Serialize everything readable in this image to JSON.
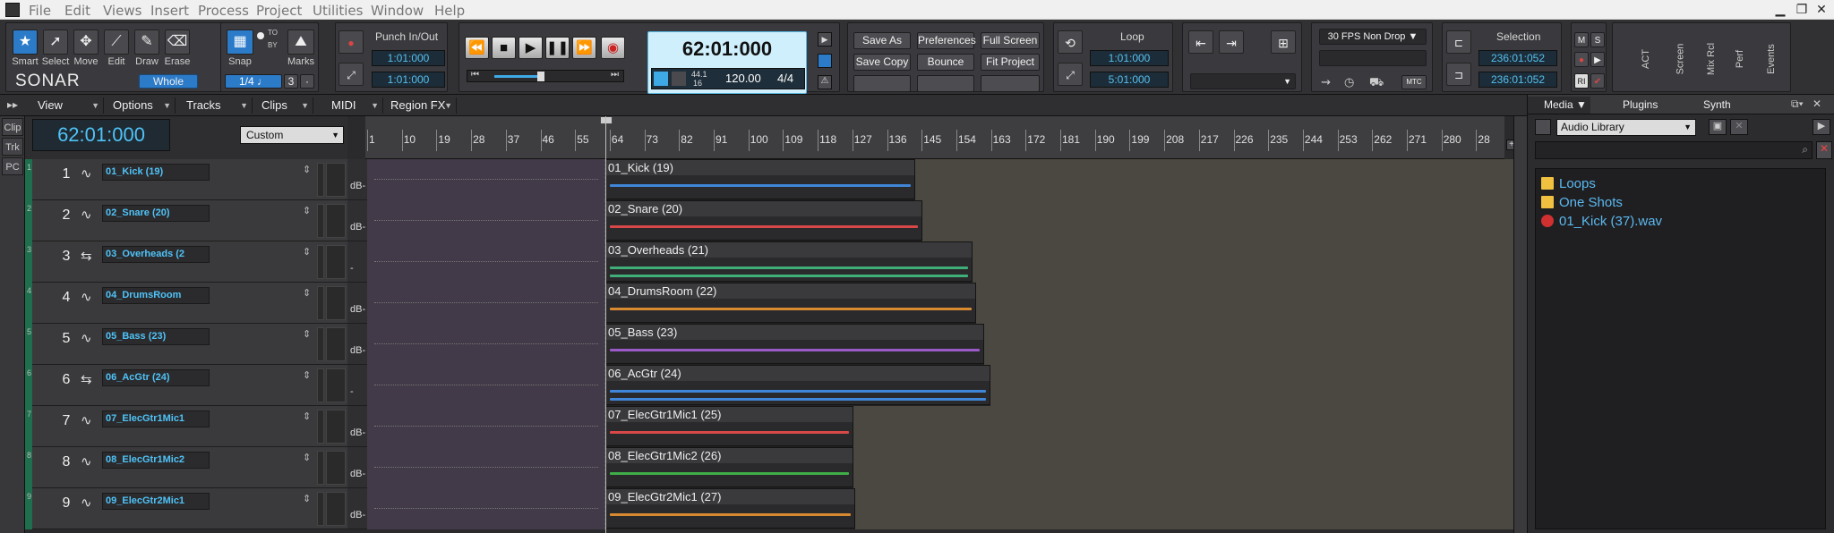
{
  "menu": [
    "File",
    "Edit",
    "Views",
    "Insert",
    "Process",
    "Project",
    "Utilities",
    "Window",
    "Help"
  ],
  "tools": [
    {
      "label": "Smart",
      "icon": "star-icon",
      "selected": true
    },
    {
      "label": "Select",
      "icon": "arrow-icon"
    },
    {
      "label": "Move",
      "icon": "move-icon"
    },
    {
      "label": "Edit",
      "icon": "edit-icon"
    },
    {
      "label": "Draw",
      "icon": "pencil-icon"
    },
    {
      "label": "Erase",
      "icon": "eraser-icon"
    }
  ],
  "logo": "SONAR",
  "whole_label": "Whole",
  "snap_label": "Snap",
  "snap_value": "1/4",
  "snap_num": "3",
  "marks_label": "Marks",
  "to_label": "TO",
  "by_label": "BY",
  "punch": {
    "title": "Punch In/Out",
    "start": "1:01:000",
    "end": "1:01:000"
  },
  "transport": {
    "time": "62:01:000",
    "sample_rate": "44.1",
    "bit_depth": "16",
    "tempo": "120.00",
    "meter": "4/4"
  },
  "buttons": {
    "save_as": "Save As",
    "preferences": "Preferences",
    "full_screen": "Full Screen",
    "save_copy": "Save Copy",
    "bounce": "Bounce",
    "fit_project": "Fit Project"
  },
  "loop": {
    "title": "Loop",
    "start": "1:01:000",
    "end": "5:01:000"
  },
  "fps": "30 FPS Non Drop",
  "mtc": "MTC",
  "selection": {
    "title": "Selection",
    "start": "236:01:052",
    "end": "236:01:052"
  },
  "right_mods": {
    "m": "M",
    "s": "S",
    "ri": "RI",
    "act": "ACT",
    "screen": "Screen",
    "mixrcl": "Mix Rcl",
    "perf": "Perf",
    "events": "Events"
  },
  "menus2": [
    "View",
    "Options",
    "Tracks",
    "Clips",
    "MIDI",
    "Region FX"
  ],
  "left_tabs": [
    "Clip",
    "Trk",
    "PC"
  ],
  "now_time": "62:01:000",
  "custom_label": "Custom",
  "ruler": [
    "1",
    "10",
    "19",
    "28",
    "37",
    "46",
    "55",
    "64",
    "73",
    "82",
    "91",
    "100",
    "109",
    "118",
    "127",
    "136",
    "145",
    "154",
    "163",
    "172",
    "181",
    "190",
    "199",
    "208",
    "217",
    "226",
    "235",
    "244",
    "253",
    "262",
    "271",
    "280",
    "28"
  ],
  "tracks": [
    {
      "num": "1",
      "name": "01_Kick (19)",
      "clip": "01_Kick (19)",
      "type": "mono",
      "db": "dB-",
      "color": "#3f86d8",
      "end": 0.478
    },
    {
      "num": "2",
      "name": "02_Snare (20)",
      "clip": "02_Snare (20)",
      "type": "mono",
      "db": "dB-",
      "color": "#d84848",
      "end": 0.484
    },
    {
      "num": "3",
      "name": "03_Overheads (2",
      "clip": "03_Overheads (21)",
      "type": "stereo",
      "db": "-",
      "color": "#3fae78",
      "end": 0.528
    },
    {
      "num": "4",
      "name": "04_DrumsRoom",
      "clip": "04_DrumsRoom (22)",
      "type": "mono",
      "db": "dB-",
      "color": "#d88a30",
      "end": 0.531
    },
    {
      "num": "5",
      "name": "05_Bass (23)",
      "clip": "05_Bass (23)",
      "type": "mono",
      "db": "dB-",
      "color": "#9a5ac8",
      "end": 0.538
    },
    {
      "num": "6",
      "name": "06_AcGtr (24)",
      "clip": "06_AcGtr (24)",
      "type": "stereo",
      "db": "-",
      "color": "#3f86d8",
      "end": 0.544
    },
    {
      "num": "7",
      "name": "07_ElecGtr1Mic1",
      "clip": "07_ElecGtr1Mic1 (25)",
      "type": "mono",
      "db": "dB-",
      "color": "#d84848",
      "end": 0.424
    },
    {
      "num": "8",
      "name": "08_ElecGtr1Mic2",
      "clip": "08_ElecGtr1Mic2 (26)",
      "type": "mono",
      "db": "dB-",
      "color": "#3fae48",
      "end": 0.424
    },
    {
      "num": "9",
      "name": "09_ElecGtr2Mic1",
      "clip": "09_ElecGtr2Mic1 (27)",
      "type": "mono",
      "db": "dB-",
      "color": "#d88a30",
      "end": 0.426
    }
  ],
  "browser": {
    "tabs": [
      "Media",
      "Plugins",
      "Synth"
    ],
    "library": "Audio Library",
    "items": [
      {
        "label": "Loops",
        "icon": "folder-icon"
      },
      {
        "label": "One Shots",
        "icon": "folder-icon"
      },
      {
        "label": "01_Kick (37).wav",
        "icon": "headphones-icon"
      }
    ]
  }
}
